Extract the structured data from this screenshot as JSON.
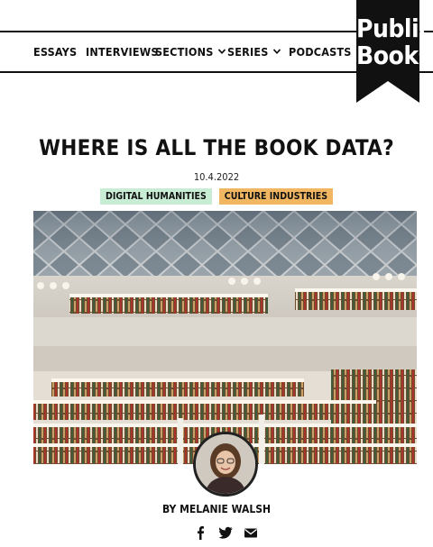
{
  "nav": {
    "items": [
      {
        "label": "ESSAYS",
        "dropdown": false
      },
      {
        "label": "INTERVIEWS",
        "dropdown": false
      },
      {
        "label": "SECTIONS",
        "dropdown": true
      },
      {
        "label": "SERIES",
        "dropdown": true
      },
      {
        "label": "PODCASTS",
        "dropdown": true
      }
    ],
    "icons": {
      "dropdown": "chevron-down-icon"
    }
  },
  "logo": {
    "line1": "Public",
    "line2": "Books",
    "color": "#111111"
  },
  "article": {
    "title": "WHERE IS ALL THE BOOK DATA?",
    "date": "10.4.2022",
    "tags": [
      {
        "label": "DIGITAL HUMANITIES",
        "color": "#c8ecd4"
      },
      {
        "label": "CULTURE INDUSTRIES",
        "color": "#f0b662"
      }
    ],
    "byline": "BY MELANIE WALSH"
  },
  "share": {
    "icons": [
      "facebook-icon",
      "twitter-icon",
      "email-icon"
    ]
  }
}
